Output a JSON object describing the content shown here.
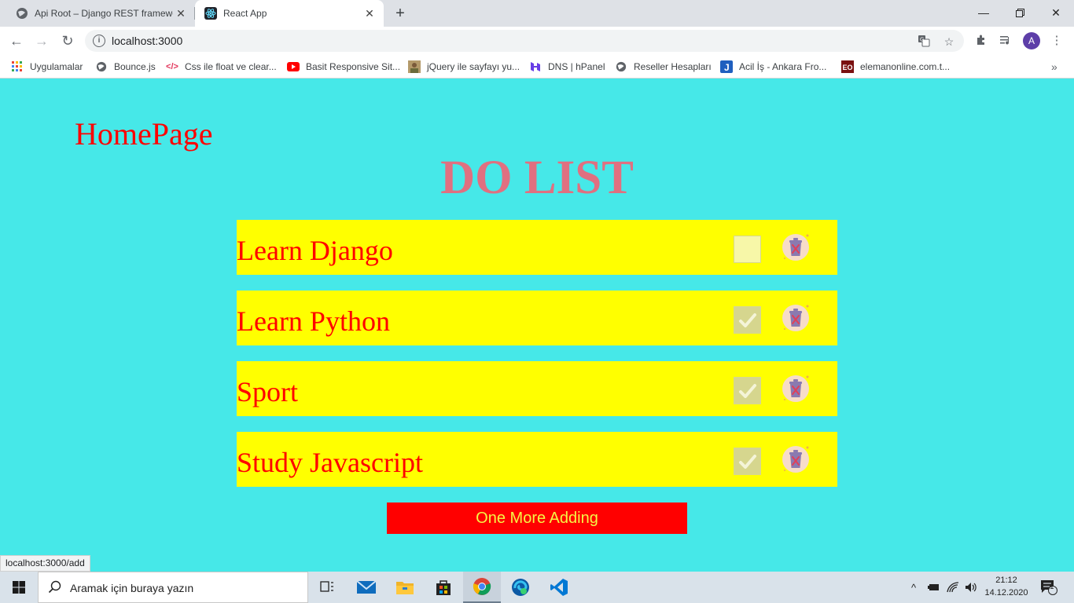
{
  "browser": {
    "tabs": [
      {
        "title": "Api Root – Django REST framewo",
        "active": false
      },
      {
        "title": "React App",
        "active": true
      }
    ],
    "url": "localhost:3000",
    "profile_initial": "A",
    "bookmarks": [
      {
        "label": "Uygulamalar",
        "icon": "apps-grid-icon"
      },
      {
        "label": "Bounce.js",
        "icon": "globe-icon"
      },
      {
        "label": "Css ile float ve clear...",
        "icon": "code-icon"
      },
      {
        "label": "Basit Responsive Sit...",
        "icon": "youtube-icon"
      },
      {
        "label": "jQuery ile sayfayı yu...",
        "icon": "avatar-thumb-icon"
      },
      {
        "label": "DNS | hPanel",
        "icon": "hpanel-icon"
      },
      {
        "label": "Reseller Hesapları",
        "icon": "globe-icon"
      },
      {
        "label": "Acil İş - Ankara Fro...",
        "icon": "j-icon"
      },
      {
        "label": "elemanonline.com.t...",
        "icon": "eo-icon"
      }
    ],
    "status_url": "localhost:3000/add"
  },
  "app": {
    "home_link": "HomePage",
    "title": "DO LIST",
    "todos": [
      {
        "text": "Learn Django",
        "completed": false
      },
      {
        "text": "Learn Python",
        "completed": true
      },
      {
        "text": "Sport",
        "completed": true
      },
      {
        "text": "Study Javascript",
        "completed": true
      }
    ],
    "add_button": "One More Adding",
    "colors": {
      "background": "#46e8e8",
      "item_background": "#ffff00",
      "text_red": "#ff0000",
      "title_pink": "#e07080",
      "button_text": "#f5f545"
    }
  },
  "taskbar": {
    "search_placeholder": "Aramak için buraya yazın",
    "time": "21:12",
    "date": "14.12.2020",
    "notification_count": "1"
  }
}
